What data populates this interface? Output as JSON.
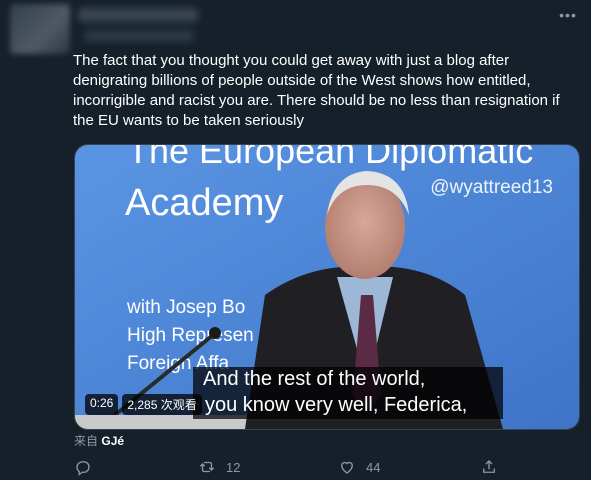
{
  "tweet": {
    "text": "The fact that you thought you could get away with just a blog after\ndenigrating billions of people outside of the West shows how entitled,\nincorrigible and racist you are. There should be no less than resignation if\nthe EU wants to be taken seriously"
  },
  "media": {
    "banner_line1": "The European Diplomatic",
    "banner_line2": "Academy",
    "speaker_line1": "with Josep Bo",
    "speaker_line2": "High Represen",
    "speaker_line3": "Foreign Affa",
    "watermark": "@wyattreed13",
    "subtitle_line1": "And the rest of the world,",
    "subtitle_line2": "you know very well, Federica,",
    "duration": "0:26",
    "views": "2,285 次观看"
  },
  "source": {
    "prefix": "来自",
    "name": "GJé"
  },
  "actions": {
    "reply_count": "",
    "retweet_count": "12",
    "like_count": "44"
  },
  "colors": {
    "background": "#15202b",
    "muted": "#8b98a5",
    "slide_blue": "#4a86d8"
  }
}
